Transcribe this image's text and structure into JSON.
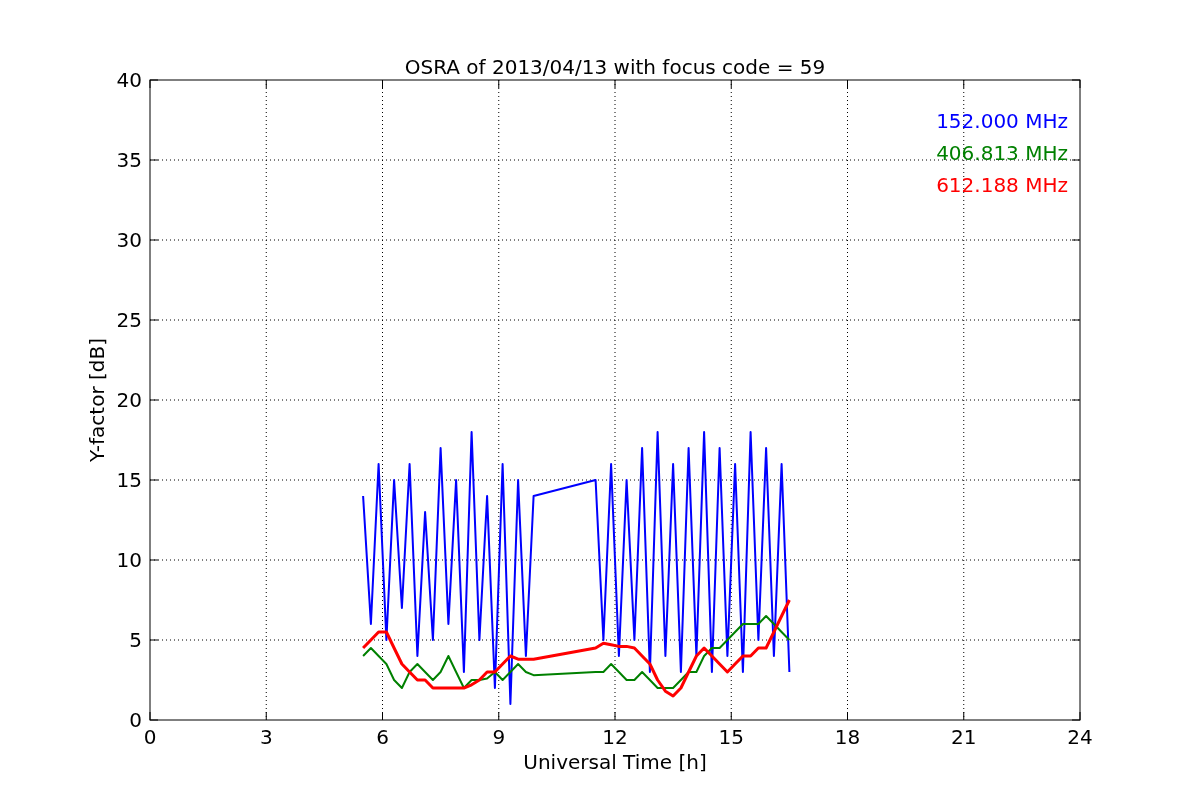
{
  "chart_data": {
    "type": "line",
    "title": "OSRA of 2013/04/13 with focus code = 59",
    "xlabel": "Universal Time [h]",
    "ylabel": "Y-factor [dB]",
    "x": [
      5.5,
      5.7,
      5.9,
      6.1,
      6.3,
      6.5,
      6.7,
      6.9,
      7.1,
      7.3,
      7.5,
      7.7,
      7.9,
      8.1,
      8.3,
      8.5,
      8.7,
      8.9,
      9.1,
      9.3,
      9.5,
      9.7,
      9.9,
      11.5,
      11.7,
      11.9,
      12.1,
      12.3,
      12.5,
      12.7,
      12.9,
      13.1,
      13.3,
      13.5,
      13.7,
      13.9,
      14.1,
      14.3,
      14.5,
      14.7,
      14.9,
      15.1,
      15.3,
      15.5,
      15.7,
      15.9,
      16.1,
      16.3,
      16.5
    ],
    "series": [
      {
        "name": "152.000 MHz",
        "color": "#0000ff",
        "values": [
          14,
          6,
          16,
          5,
          15,
          7,
          16,
          4,
          13,
          5,
          17,
          6,
          15,
          3,
          18,
          5,
          14,
          2,
          16,
          1,
          15,
          4,
          14,
          15,
          5,
          16,
          4,
          15,
          5,
          17,
          3,
          18,
          4,
          16,
          3,
          17,
          4,
          18,
          3,
          17,
          4,
          16,
          3,
          18,
          5,
          17,
          4,
          16,
          3
        ]
      },
      {
        "name": "406.813 MHz",
        "color": "#008000",
        "values": [
          4,
          4.5,
          4,
          3.5,
          2.5,
          2,
          3,
          3.5,
          3,
          2.5,
          3,
          4,
          3,
          2,
          2.5,
          2.5,
          2.6,
          3,
          2.5,
          3,
          3.5,
          3,
          2.8,
          3,
          3,
          3.5,
          3,
          2.5,
          2.5,
          3,
          2.5,
          2,
          2,
          2,
          2.5,
          3,
          3,
          4,
          4.5,
          4.5,
          5,
          5.5,
          6,
          6,
          6,
          6.5,
          6,
          5.5,
          5
        ]
      },
      {
        "name": "612.188 MHz",
        "color": "#ff0000",
        "values": [
          4.5,
          5,
          5.5,
          5.5,
          4.5,
          3.5,
          3,
          2.5,
          2.5,
          2,
          2,
          2,
          2,
          2,
          2.2,
          2.5,
          3,
          3,
          3.5,
          4,
          3.8,
          3.8,
          3.8,
          4.5,
          4.8,
          4.7,
          4.6,
          4.6,
          4.5,
          4,
          3.5,
          2.5,
          1.8,
          1.5,
          2,
          3,
          4,
          4.5,
          4,
          3.5,
          3,
          3.5,
          4,
          4,
          4.5,
          4.5,
          5.5,
          6.5,
          7.5
        ]
      }
    ],
    "grid": true,
    "xlim": [
      0,
      24
    ],
    "ylim": [
      0,
      40
    ],
    "xticks": [
      0,
      3,
      6,
      9,
      12,
      15,
      18,
      21,
      24
    ],
    "yticks": [
      0,
      5,
      10,
      15,
      20,
      25,
      30,
      35,
      40
    ]
  }
}
